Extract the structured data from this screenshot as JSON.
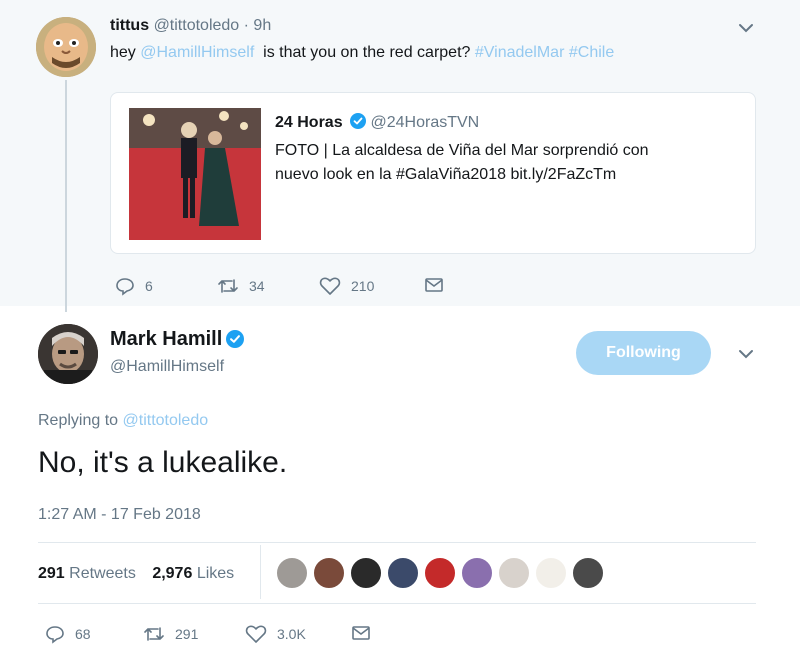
{
  "parent_tweet": {
    "display_name": "tittus",
    "handle": "@tittotoledo",
    "time": "· 9h",
    "text_prefix": "hey ",
    "mention": "@HamillHimself",
    "text_middle": "  is that you on the red carpet? ",
    "hashtag1": "#VinadelMar",
    "hashtag2": "#Chile",
    "quoted": {
      "display_name": "24 Horas",
      "handle": "@24HorasTVN",
      "text_line1": "FOTO | La alcaldesa de Viña del Mar sorprendió con",
      "text_line2": "nuevo look en la #GalaViña2018 bit.ly/2FaZcTm"
    },
    "actions": {
      "reply_count": "6",
      "retweet_count": "34",
      "like_count": "210"
    }
  },
  "main_tweet": {
    "display_name": "Mark Hamill",
    "handle": "@HamillHimself",
    "follow_label": "Following",
    "replying_prefix": "Replying to ",
    "replying_to": "@tittotoledo",
    "text": "No, it's a lukealike.",
    "timestamp": "1:27 AM - 17 Feb 2018",
    "retweets_count": "291",
    "retweets_label": "Retweets",
    "likes_count": "2,976",
    "likes_label": "Likes",
    "actions": {
      "reply_count": "68",
      "retweet_count": "291",
      "like_count": "3.0K"
    }
  },
  "icons": [
    "chevron-down-icon",
    "verified-badge-icon",
    "reply-icon",
    "retweet-icon",
    "like-icon",
    "message-icon"
  ],
  "colors": {
    "link": "#94c9f0",
    "follow_button": "#a9d7f5",
    "muted_text": "#657786",
    "verified": "#1da1f2",
    "parent_bg": "#f5f8fa"
  }
}
